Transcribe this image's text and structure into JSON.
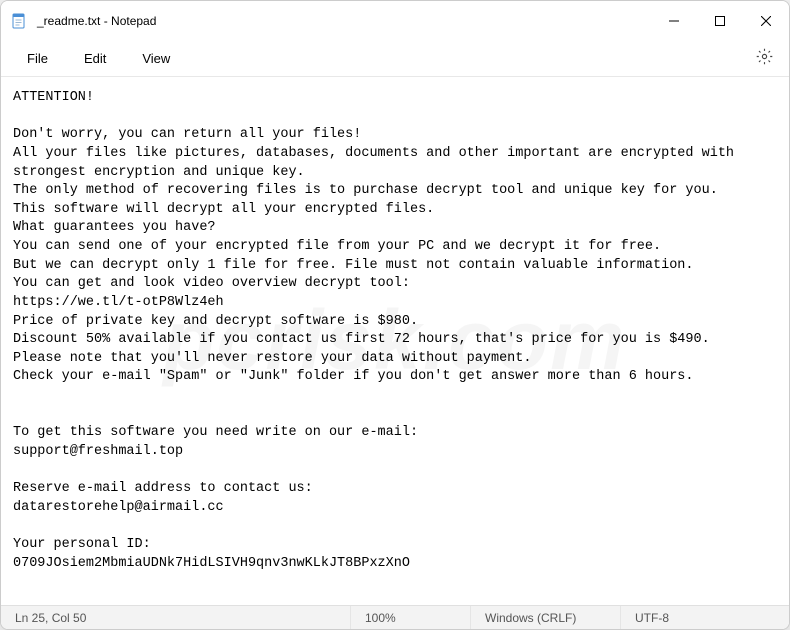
{
  "window": {
    "title": "_readme.txt - Notepad"
  },
  "menu": {
    "file": "File",
    "edit": "Edit",
    "view": "View"
  },
  "content": {
    "text": "ATTENTION!\n\nDon't worry, you can return all your files!\nAll your files like pictures, databases, documents and other important are encrypted with strongest encryption and unique key.\nThe only method of recovering files is to purchase decrypt tool and unique key for you.\nThis software will decrypt all your encrypted files.\nWhat guarantees you have?\nYou can send one of your encrypted file from your PC and we decrypt it for free.\nBut we can decrypt only 1 file for free. File must not contain valuable information.\nYou can get and look video overview decrypt tool:\nhttps://we.tl/t-otP8Wlz4eh\nPrice of private key and decrypt software is $980.\nDiscount 50% available if you contact us first 72 hours, that's price for you is $490.\nPlease note that you'll never restore your data without payment.\nCheck your e-mail \"Spam\" or \"Junk\" folder if you don't get answer more than 6 hours.\n\n\nTo get this software you need write on our e-mail:\nsupport@freshmail.top\n\nReserve e-mail address to contact us:\ndatarestorehelp@airmail.cc\n\nYour personal ID:\n0709JOsiem2MbmiaUDNk7HidLSIVH9qnv3nwKLkJT8BPxzXnO"
  },
  "status": {
    "position": "Ln 25, Col 50",
    "zoom": "100%",
    "eol": "Windows (CRLF)",
    "encoding": "UTF-8"
  },
  "watermark": "pcrisk.com"
}
